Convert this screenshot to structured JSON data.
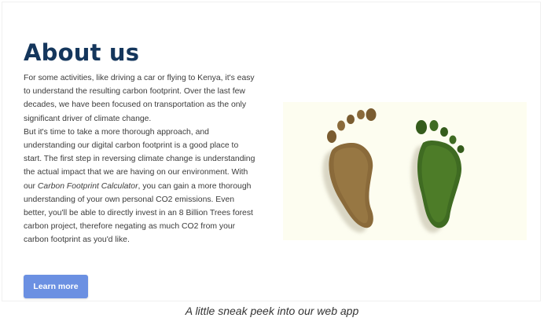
{
  "section": {
    "title": "About us",
    "paragraph_1": "For some activities, like driving a car or flying to Kenya, it's easy to understand the resulting carbon footprint. Over the last few decades, we have been focused on transportation as the only significant driver of climate change.",
    "paragraph_2_start": "But it's time to take a more thorough approach, and understanding our digital carbon footprint is a good place to start. The first step in reversing climate change is understanding the actual impact that we are having on our environment. With our ",
    "paragraph_2_emphasis": "Carbon Footprint Calculator",
    "paragraph_2_end": ", you can gain a more thorough understanding of your own personal CO2 emissions. Even better, you'll be able to directly invest in an 8 Billion Trees forest carbon project, therefore negating as much CO2 from your carbon footprint as you'd like.",
    "button_label": "Learn more"
  },
  "image": {
    "subject": "footprints-made-of-trees",
    "left_foot_color": "#8a6a3a",
    "right_foot_color": "#3f6b22"
  },
  "caption": "A little sneak peek into our web app",
  "colors": {
    "heading": "#14365c",
    "button": "#6b90e2",
    "image_background": "#fdfdf0"
  }
}
